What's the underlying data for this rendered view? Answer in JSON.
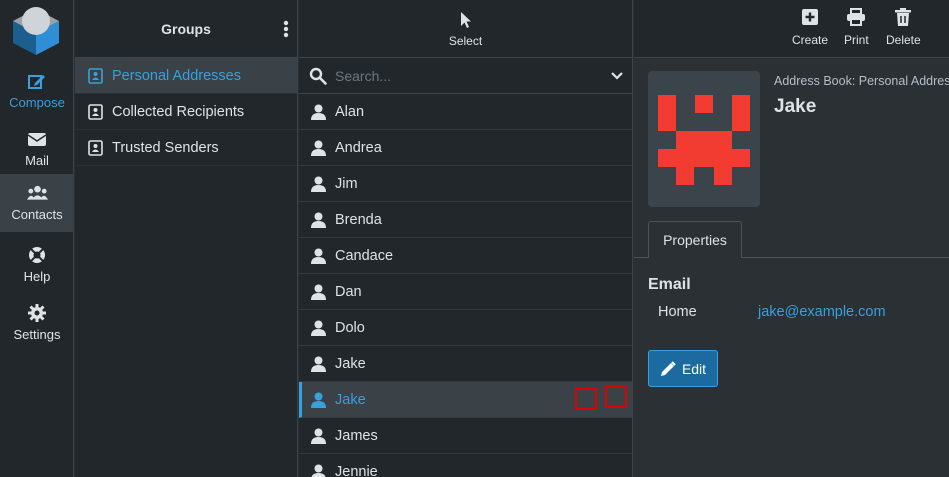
{
  "nav": {
    "items": [
      {
        "label": "Compose",
        "icon": "compose-icon"
      },
      {
        "label": "Mail",
        "icon": "mail-icon"
      },
      {
        "label": "Contacts",
        "icon": "contacts-icon"
      },
      {
        "label": "Help",
        "icon": "help-icon"
      },
      {
        "label": "Settings",
        "icon": "gear-icon"
      }
    ]
  },
  "groups": {
    "title": "Groups",
    "items": [
      {
        "label": "Personal Addresses"
      },
      {
        "label": "Collected Recipients"
      },
      {
        "label": "Trusted Senders"
      }
    ]
  },
  "list": {
    "select_label": "Select",
    "search_placeholder": "Search...",
    "contacts": [
      {
        "name": "Alan"
      },
      {
        "name": "Andrea"
      },
      {
        "name": "Jim"
      },
      {
        "name": "Brenda"
      },
      {
        "name": "Candace"
      },
      {
        "name": "Dan"
      },
      {
        "name": "Dolo"
      },
      {
        "name": "Jake"
      },
      {
        "name": "Jake"
      },
      {
        "name": "James"
      },
      {
        "name": "Jennie"
      }
    ]
  },
  "toolbar": {
    "create_label": "Create",
    "print_label": "Print",
    "delete_label": "Delete"
  },
  "detail": {
    "address_book": "Address Book: Personal Addres",
    "name": "Jake",
    "tab_label": "Properties",
    "section_label": "Email",
    "field_label": "Home",
    "field_value": "jake@example.com",
    "edit_label": "Edit"
  },
  "colors": {
    "accent": "#37a1e0",
    "background": "#22272b",
    "avatar_red": "#f33c31",
    "highlight_box": "#e00000"
  }
}
